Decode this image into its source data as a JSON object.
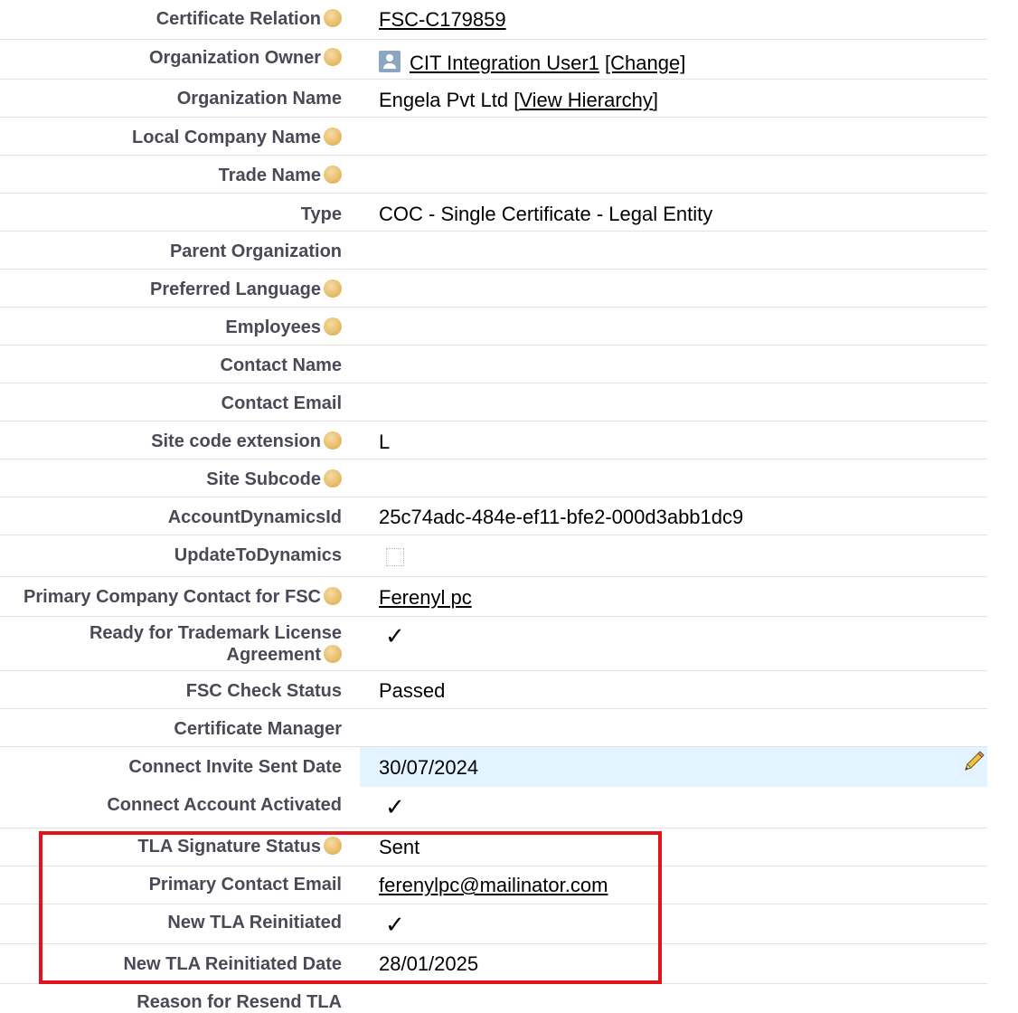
{
  "fields": {
    "certificate_relation": {
      "label": "Certificate Relation",
      "value": "FSC-C179859"
    },
    "organization_owner": {
      "label": "Organization Owner",
      "value": "CIT Integration User1",
      "action": "[Change]"
    },
    "organization_name": {
      "label": "Organization Name",
      "value": "Engela Pvt Ltd",
      "link_open": "[",
      "link": "View Hierarchy",
      "link_close": "]"
    },
    "local_company_name": {
      "label": "Local Company Name",
      "value": ""
    },
    "trade_name": {
      "label": "Trade Name",
      "value": ""
    },
    "type": {
      "label": "Type",
      "value": "COC - Single Certificate - Legal Entity"
    },
    "parent_organization": {
      "label": "Parent Organization",
      "value": ""
    },
    "preferred_language": {
      "label": "Preferred Language",
      "value": ""
    },
    "employees": {
      "label": "Employees",
      "value": ""
    },
    "contact_name": {
      "label": "Contact Name",
      "value": ""
    },
    "contact_email": {
      "label": "Contact Email",
      "value": ""
    },
    "site_code_extension": {
      "label": "Site code extension",
      "value": "L"
    },
    "site_subcode": {
      "label": "Site Subcode",
      "value": ""
    },
    "account_dynamics_id": {
      "label": "AccountDynamicsId",
      "value": "25c74adc-484e-ef11-bfe2-000d3abb1dc9"
    },
    "update_to_dynamics": {
      "label": "UpdateToDynamics",
      "checked": false
    },
    "primary_company_contact": {
      "label": "Primary Company Contact for FSC",
      "value": "Ferenyl pc"
    },
    "ready_for_tla": {
      "label": "Ready for Trademark License Agreement",
      "checked": true,
      "mark": "✓"
    },
    "fsc_check_status": {
      "label": "FSC Check Status",
      "value": "Passed"
    },
    "certificate_manager": {
      "label": "Certificate Manager",
      "value": ""
    },
    "connect_invite_sent_date": {
      "label": "Connect Invite Sent Date",
      "value": "30/07/2024"
    },
    "connect_account_activated": {
      "label": "Connect Account Activated",
      "checked": true,
      "mark": "✓"
    },
    "tla_signature_status": {
      "label": "TLA Signature Status",
      "value": "Sent"
    },
    "primary_contact_email": {
      "label": "Primary Contact Email",
      "value": "ferenylpc@mailinator.com"
    },
    "new_tla_reinitiated": {
      "label": "New TLA Reinitiated",
      "checked": true,
      "mark": "✓"
    },
    "new_tla_reinitiated_date": {
      "label": "New TLA Reinitiated Date",
      "value": "28/01/2025"
    },
    "reason_for_resend_tla": {
      "label": "Reason for Resend TLA",
      "value": ""
    }
  },
  "icons": {
    "help": "help-icon",
    "user": "user-icon",
    "edit": "pencil-icon"
  },
  "colors": {
    "highlight_row": "#e3f3ff",
    "annotation_box": "#e1141c",
    "help_icon": "#e7bd6a"
  }
}
